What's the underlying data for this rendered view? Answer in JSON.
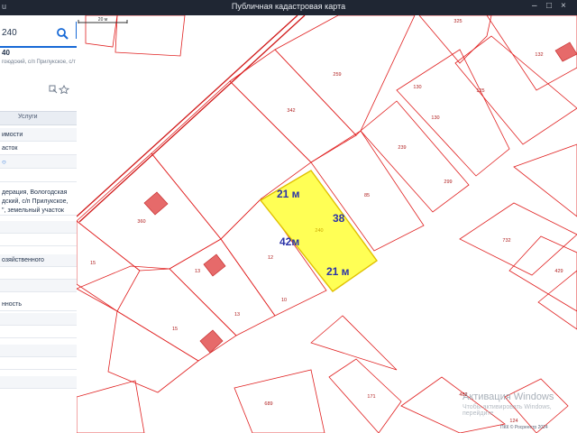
{
  "window": {
    "title": "Публичная кадастровая карта",
    "left_tab": "u"
  },
  "panel": {
    "search_value": "240",
    "object_title": "40",
    "object_address": "гоюдский, с/п Прилукское, с/т",
    "tabs": [
      "Услуги"
    ],
    "rows": [
      "имости",
      "асток",
      "",
      "дерация, Вологодская",
      "дский, с/п Прилукское,",
      "\", земельный участок",
      "озяйственного",
      "нность"
    ]
  },
  "map": {
    "highlight_parcel": {
      "label": "240",
      "dimensions": {
        "top": "21 м",
        "right": "38",
        "left": "42м",
        "bottom": "21 м"
      },
      "fill_color": "#ffff55",
      "border_color": "#e0c000"
    },
    "parcel_labels": [
      "325",
      "132",
      "259",
      "130",
      "125",
      "342",
      "130",
      "239",
      "299",
      "85",
      "360",
      "732",
      "15",
      "12",
      "13",
      "10",
      "15",
      "13",
      "429",
      "689",
      "171",
      "482",
      "124"
    ],
    "scale_label": "20 м",
    "attribution": "ПКК © Росреестр 2024",
    "parcel_color": "#e02020",
    "road_color": "#d01818"
  },
  "watermark": {
    "line1": "Активация Windows",
    "line2": "Чтобы активировать Windows, перейдите"
  }
}
